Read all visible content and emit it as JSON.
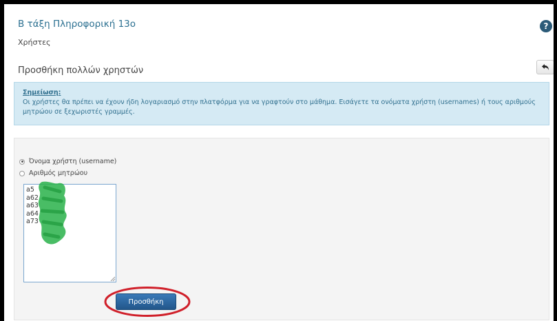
{
  "header": {
    "course_title": "Β τάξη Πληροφορική 13ο",
    "breadcrumb": "Χρήστες",
    "help_icon": "question-circle-icon",
    "highlight_color": "#d0202a",
    "link_color": "#2a6f90"
  },
  "page": {
    "title": "Προσθήκη πολλών χρηστών",
    "back_icon": "reply-arrow-icon"
  },
  "note": {
    "title": "Σημείωση",
    "title_suffix": ":",
    "text": "Οι χρήστες θα πρέπει να έχουν ήδη λογαριασμό στην πλατφόρμα για να γραφτούν στο μάθημα. Εισάγετε τα ονόματα χρήστη (usernames) ή τους αριθμούς μητρώου σε ξεχωριστές γραμμές.",
    "background": "#d5eaf4"
  },
  "form": {
    "radio_options": [
      {
        "label": "Όνομα χρήστη (username)",
        "checked": true
      },
      {
        "label": "Αριθμός μητρώου",
        "checked": false
      }
    ],
    "usernames_value": "a5\na62\na63\na64\na73",
    "submit_label": "Προσθήκη",
    "submit_color": "#2e6aa6"
  }
}
